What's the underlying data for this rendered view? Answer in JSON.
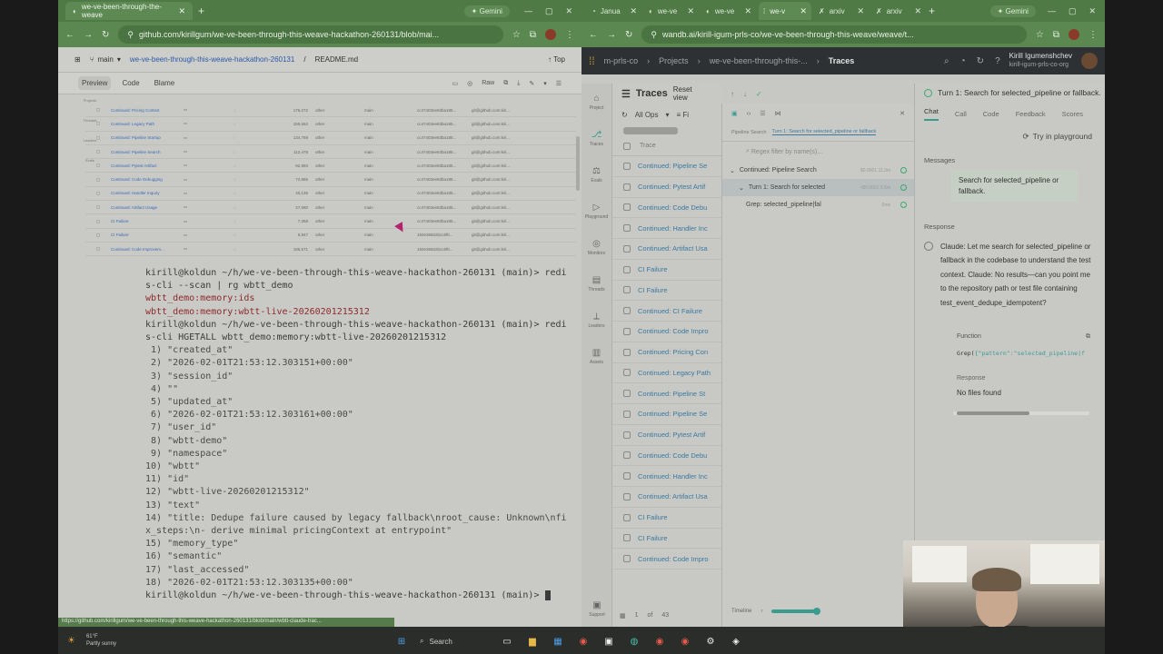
{
  "left": {
    "tabs": [
      {
        "label": "we-ve-been-through-the-weave"
      }
    ],
    "gemini_label": "Gemini",
    "url": "github.com/kirillgum/we-ve-been-through-this-weave-hackathon-260131/blob/mai...",
    "branch": "main",
    "repo": "we-ve-been-through-this-weave-hackathon-260131",
    "file": "README.md",
    "top_label": "Top",
    "tabs_view": [
      "Preview",
      "Code",
      "Blame"
    ],
    "raw_label": "Raw",
    "nav_labels": [
      "Projects",
      "Threads",
      "Leaders",
      "Evals"
    ],
    "table_rows": [
      {
        "name": "Continued: Pricing Context",
        "num": "176,272",
        "type": "other",
        "branch": "main",
        "hash": "cc47403ee83ba185...",
        "mail": "git@github.com:kiri..."
      },
      {
        "name": "Continued: Legacy Path",
        "num": "150,552",
        "type": "other",
        "branch": "main",
        "hash": "cc47403ee83ba185...",
        "mail": "git@github.com:kiri..."
      },
      {
        "name": "Continued: Pipeline Startup",
        "num": "134,769",
        "type": "other",
        "branch": "main",
        "hash": "cc47403ee83ba185...",
        "mail": "git@github.com:kiri..."
      },
      {
        "name": "Continued: Pipeline Search",
        "num": "112,478",
        "type": "other",
        "branch": "main",
        "hash": "cc47403ee83ba185...",
        "mail": "git@github.com:kiri..."
      },
      {
        "name": "Continued: Pytest Artifact",
        "num": "92,993",
        "type": "other",
        "branch": "main",
        "hash": "cc47403ee83ba185...",
        "mail": "git@github.com:kiri..."
      },
      {
        "name": "Continued: Code Debugging",
        "num": "72,966",
        "type": "other",
        "branch": "main",
        "hash": "cc47403ee83ba185...",
        "mail": "git@github.com:kiri..."
      },
      {
        "name": "Continued: Handler Inquiry",
        "num": "40,136",
        "type": "other",
        "branch": "main",
        "hash": "cc47403ee83ba185...",
        "mail": "git@github.com:kiri..."
      },
      {
        "name": "Continued: Artifact Usage",
        "num": "27,680",
        "type": "other",
        "branch": "main",
        "hash": "cc47403ee83ba185...",
        "mail": "git@github.com:kiri..."
      },
      {
        "name": "CI Failure",
        "num": "7,358",
        "type": "other",
        "branch": "main",
        "hash": "cc47403ee83ba185...",
        "mail": "git@github.com:kiri..."
      },
      {
        "name": "CI Failure",
        "num": "6,947",
        "type": "other",
        "branch": "main",
        "hash": "160e36502bcc6f0...",
        "mail": "git@github.com:kiri..."
      },
      {
        "name": "Continued: Code Improvem...",
        "num": "185,671",
        "type": "other",
        "branch": "main",
        "hash": "160e36502bcc6f0...",
        "mail": "git@github.com:kiri..."
      }
    ],
    "terminal": [
      {
        "kind": "prompt",
        "text": "kirill@koldun ~/h/we-ve-been-through-this-weave-hackathon-260131 (main)> redi"
      },
      {
        "kind": "cmd",
        "text": "s-cli --scan | rg wbtt_demo"
      },
      {
        "kind": "red",
        "text": "wbtt_demo:memory:ids"
      },
      {
        "kind": "red",
        "text": "wbtt_demo:memory:wbtt-live-20260201215312"
      },
      {
        "kind": "prompt",
        "text": "kirill@koldun ~/h/we-ve-been-through-this-weave-hackathon-260131 (main)> redi"
      },
      {
        "kind": "cmd",
        "text": "s-cli HGETALL wbtt_demo:memory:wbtt-live-20260201215312"
      },
      {
        "kind": "out",
        "text": " 1) \"created_at\""
      },
      {
        "kind": "out",
        "text": " 2) \"2026-02-01T21:53:12.303151+00:00\""
      },
      {
        "kind": "out",
        "text": " 3) \"session_id\""
      },
      {
        "kind": "out",
        "text": " 4) \"\""
      },
      {
        "kind": "out",
        "text": " 5) \"updated_at\""
      },
      {
        "kind": "out",
        "text": " 6) \"2026-02-01T21:53:12.303161+00:00\""
      },
      {
        "kind": "out",
        "text": " 7) \"user_id\""
      },
      {
        "kind": "out",
        "text": " 8) \"wbtt-demo\""
      },
      {
        "kind": "out",
        "text": " 9) \"namespace\""
      },
      {
        "kind": "out",
        "text": "10) \"wbtt\""
      },
      {
        "kind": "out",
        "text": "11) \"id\""
      },
      {
        "kind": "out",
        "text": "12) \"wbtt-live-20260201215312\""
      },
      {
        "kind": "out",
        "text": "13) \"text\""
      },
      {
        "kind": "out",
        "text": "14) \"title: Dedupe failure caused by legacy fallback\\nroot_cause: Unknown\\nfi"
      },
      {
        "kind": "out",
        "text": "x_steps:\\n- derive minimal pricingContext at entrypoint\""
      },
      {
        "kind": "out",
        "text": "15) \"memory_type\""
      },
      {
        "kind": "out",
        "text": "16) \"semantic\""
      },
      {
        "kind": "out",
        "text": "17) \"last_accessed\""
      },
      {
        "kind": "out",
        "text": "18) \"2026-02-01T21:53:12.303135+00:00\""
      },
      {
        "kind": "prompt",
        "text": "kirill@koldun ~/h/we-ve-been-through-this-weave-hackathon-260131 (main)> "
      }
    ],
    "status_url": "https://github.com/kirillgum/we-ve-been-through-this-weave-hackathon-260131/blob/main/wbtt-claude-trac..."
  },
  "right": {
    "tabs": [
      "Janua",
      "we-ve",
      "we-ve",
      "we-v",
      "arxiv",
      "arxiv"
    ],
    "gemini_label": "Gemini",
    "url": "wandb.ai/kirill-igum-prls-co/we-ve-been-through-this-weave/weave/t...",
    "org": "m-prls-co",
    "projects_label": "Projects",
    "project_name": "we-ve-been-through-this-...",
    "current": "Traces",
    "user_name": "Kirill Igumenshchev",
    "user_org": "kirill-igum-prls-co-org",
    "rail": [
      "Project",
      "Traces",
      "Evals",
      "Playground",
      "Monitors",
      "Threads",
      "Leaders",
      "Assets"
    ],
    "support_label": "Support",
    "traces_title": "Traces",
    "reset_view": "Reset view",
    "all_ops": "All Ops",
    "filter_label": "Fi",
    "trace_col": "Trace",
    "traces": [
      "Continued: Pipeline Se",
      "Continued: Pytest Artif",
      "Continued: Code Debu",
      "Continued: Handler Inc",
      "Continued: Artifact Usa",
      "CI Failure",
      "CI Failure",
      "Continued: CI Failure",
      "Continued: Code Impro",
      "Continued: Pricing Con",
      "Continued: Legacy Path",
      "Continued: Pipeline St",
      "Continued: Pipeline Se",
      "Continued: Pytest Artif",
      "Continued: Code Debu",
      "Continued: Handler Inc",
      "Continued: Artifact Usa",
      "CI Failure",
      "CI Failure",
      "Continued: Code Impro"
    ],
    "pager": {
      "page": "1",
      "of": "of",
      "total": "43"
    },
    "turn_title": "Turn 1: Search for selected_pipeline or fallback.",
    "crumbs": [
      "Pipeline Search",
      "Turn 1: Search for selected_pipeline or fallback"
    ],
    "regex_placeholder": "Regex filter by name(s)...",
    "tree": [
      {
        "label": "Continued: Pipeline Search",
        "meta": "$0.0001  11.3m",
        "indent": 8
      },
      {
        "label": "Turn 1: Search for selected",
        "meta": "<$0.0001  5.5m",
        "indent": 18,
        "sel": true
      },
      {
        "label": "Grep: selected_pipeline|fal",
        "meta": "0ms",
        "indent": 26
      }
    ],
    "timeline_label": "Timeline",
    "detail_tabs": [
      "Chat",
      "Call",
      "Code",
      "Feedback",
      "Scores"
    ],
    "try_playground": "Try in playground",
    "messages_label": "Messages",
    "user_msg": "Search for selected_pipeline or fallback.",
    "response_label": "Response",
    "claude_msg": "Claude: Let me search for selected_pipeline or fallback in the codebase to understand the test context. Claude: No results—can you point me to the repository path or test file containing test_event_dedupe_idempotent?",
    "function_label": "Function",
    "fn_name": "Grep(",
    "fn_args": "{\"pattern\":\"selected_pipeline|f",
    "fn_response_label": "Response",
    "fn_response": "No files found"
  },
  "taskbar": {
    "temp": "61°F",
    "weather": "Partly sunny",
    "search": "Search"
  },
  "colors": {
    "chrome_green": "#4f7a46",
    "wandb_header": "#2e3133",
    "accent_teal": "#3a9c8f",
    "link_blue": "#3b7a9e"
  }
}
